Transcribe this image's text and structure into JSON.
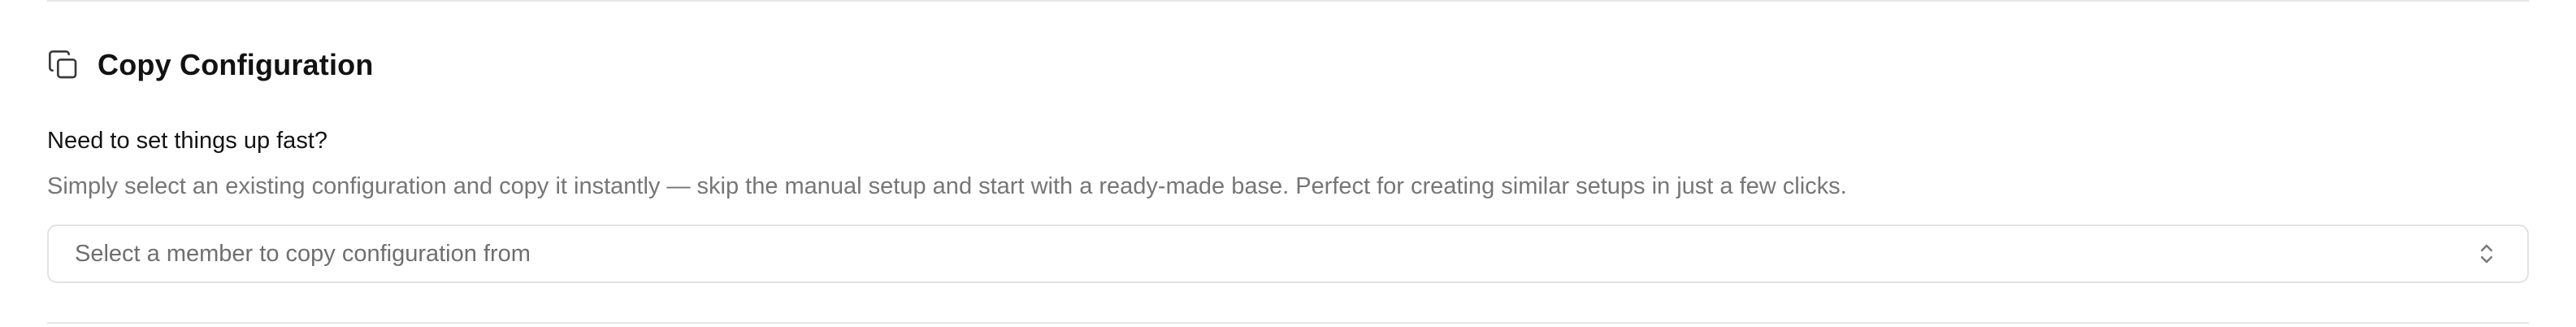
{
  "section": {
    "title": "Copy Configuration",
    "icon": "copy-icon"
  },
  "intro": {
    "question": "Need to set things up fast?",
    "description": "Simply select an existing configuration and copy it instantly — skip the manual setup and start with a ready-made base. Perfect for creating similar setups in just a few clicks."
  },
  "member_select": {
    "placeholder": "Select a member to copy configuration from",
    "icon": "chevrons-up-down-icon"
  },
  "colors": {
    "title_text": "#121212",
    "muted_text": "#767676",
    "border": "#e3e3e3",
    "divider": "#e6e6e6"
  }
}
